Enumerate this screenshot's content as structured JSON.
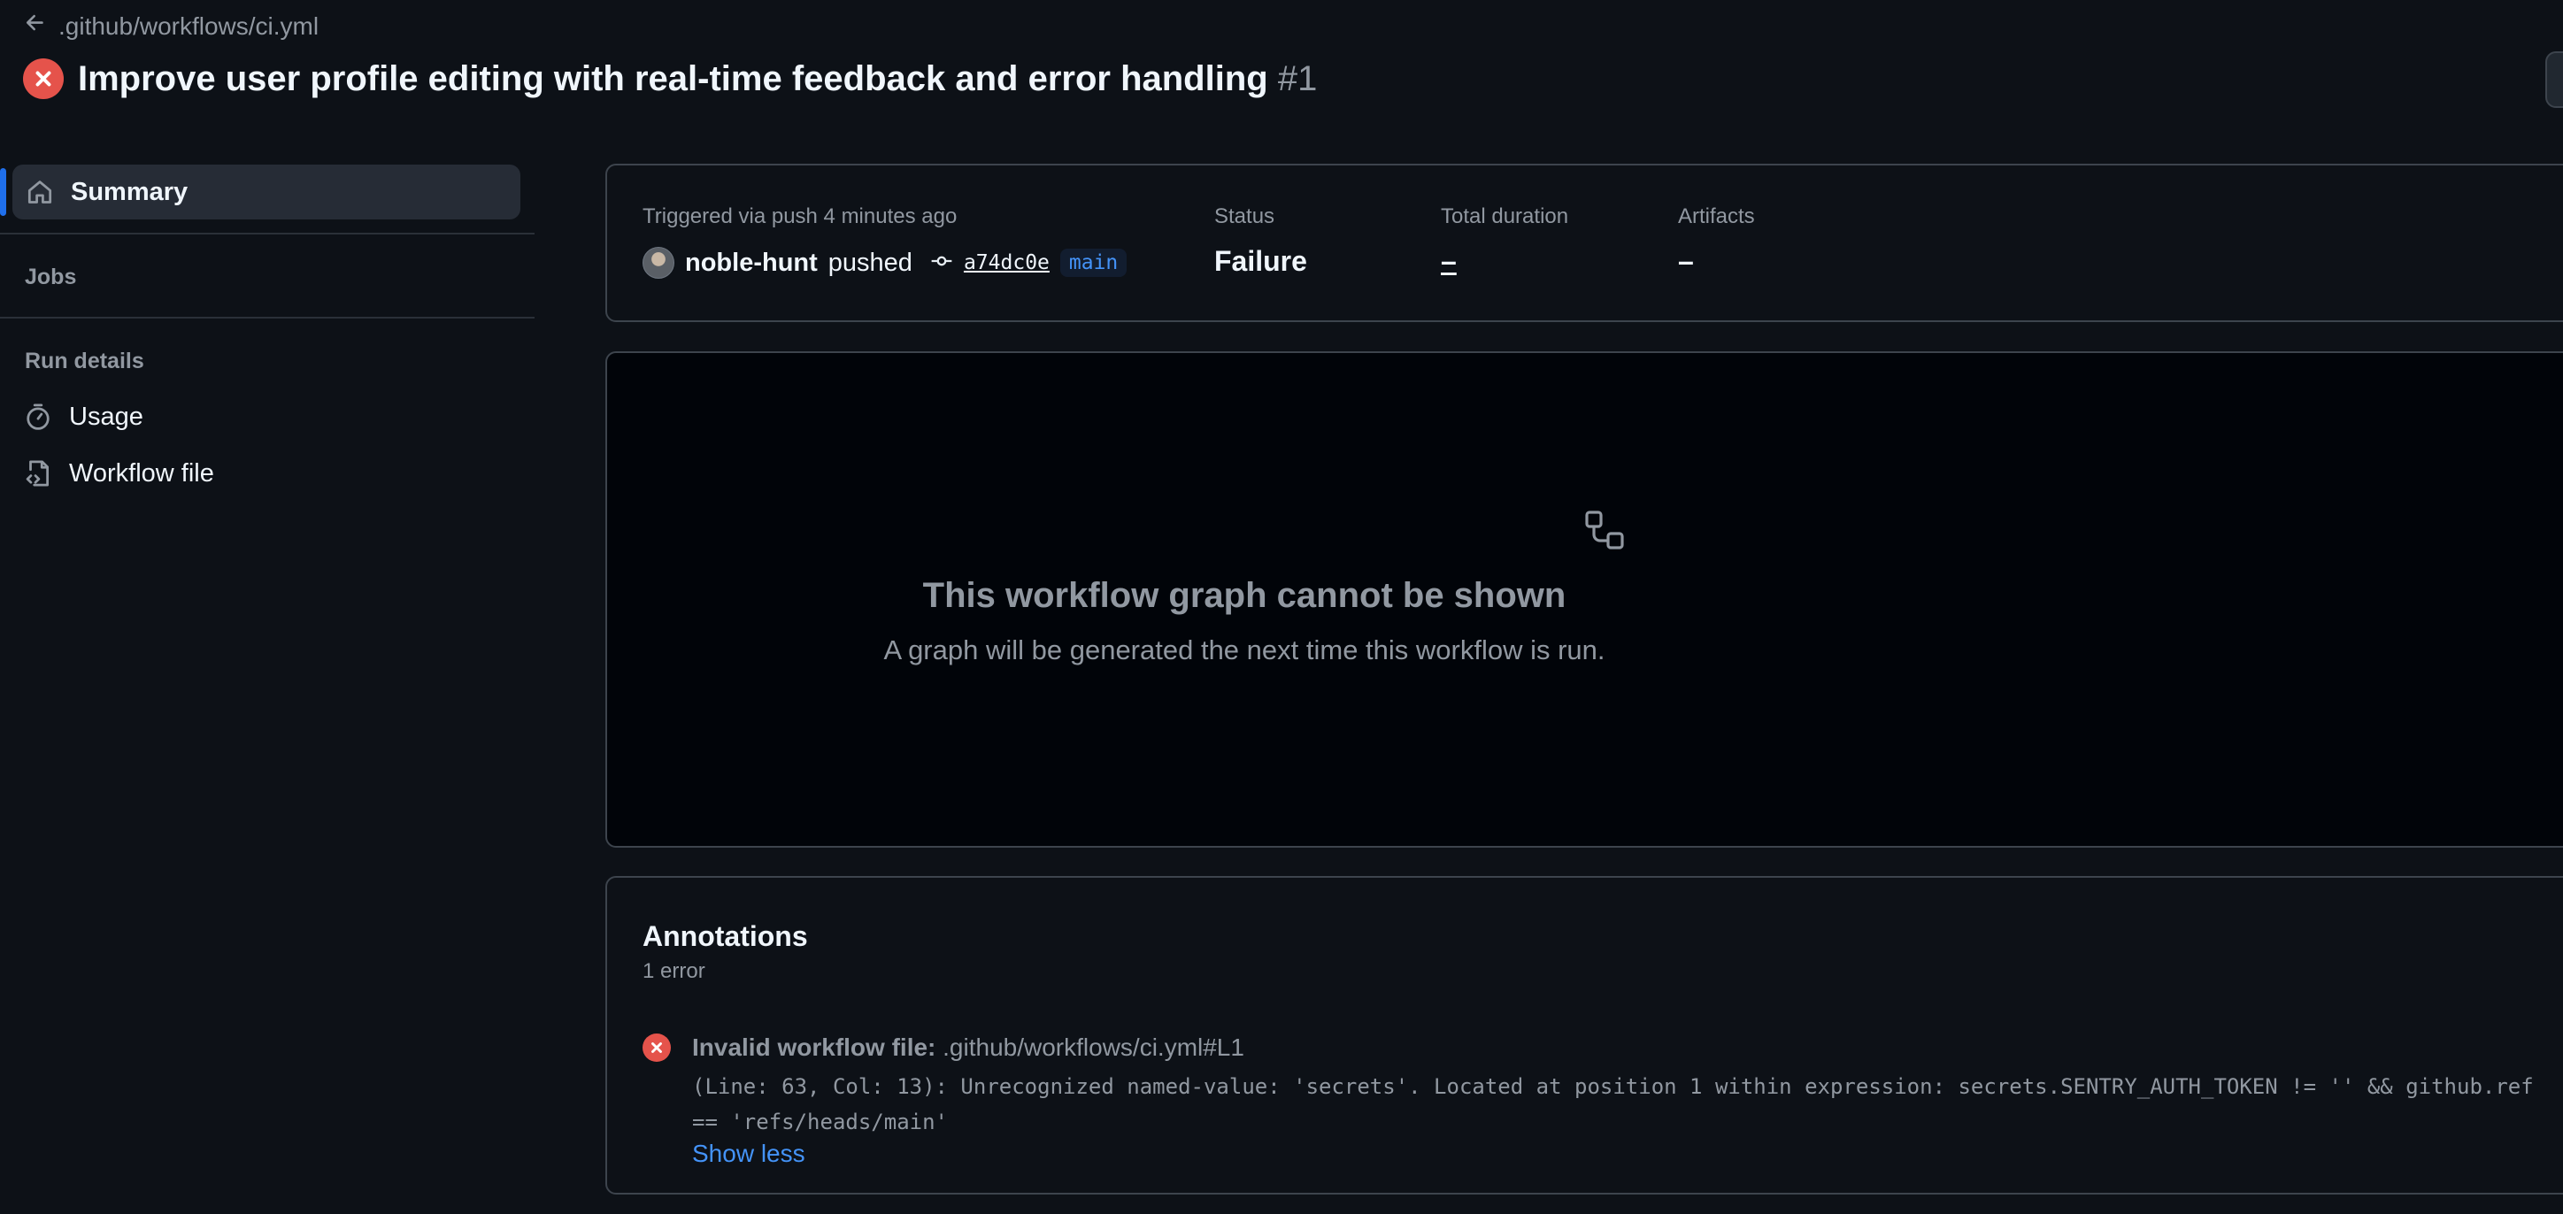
{
  "header": {
    "back_label": ".github/workflows/ci.yml",
    "run_title": "Improve user profile editing with real-time feedback and error handling",
    "run_number": "#1"
  },
  "sidebar": {
    "summary_label": "Summary",
    "jobs_heading": "Jobs",
    "run_details_heading": "Run details",
    "items": [
      {
        "label": "Usage",
        "icon": "stopwatch-icon"
      },
      {
        "label": "Workflow file",
        "icon": "file-code-icon"
      }
    ]
  },
  "summary": {
    "trigger_text": "Triggered via push 4 minutes ago",
    "actor": "noble-hunt",
    "action": "pushed",
    "commit": "a74dc0e",
    "branch": "main",
    "status_label": "Status",
    "status_value": "Failure",
    "duration_label": "Total duration",
    "duration_value": "–",
    "artifacts_label": "Artifacts",
    "artifacts_value": "–"
  },
  "graph": {
    "title": "This workflow graph cannot be shown",
    "subtitle": "A graph will be generated the next time this workflow is run."
  },
  "annotations": {
    "title": "Annotations",
    "count": "1 error",
    "error_title": "Invalid workflow file:",
    "error_location": ".github/workflows/ci.yml#L1",
    "error_message": "(Line: 63, Col: 13): Unrecognized named-value: 'secrets'. Located at position 1 within expression: secrets.SENTRY_AUTH_TOKEN != '' && github.ref\n== 'refs/heads/main'",
    "toggle_label": "Show less"
  },
  "colors": {
    "background": "#0d1117",
    "failure": "#e5534b",
    "accent": "#4493f8",
    "muted": "#9198a1"
  }
}
